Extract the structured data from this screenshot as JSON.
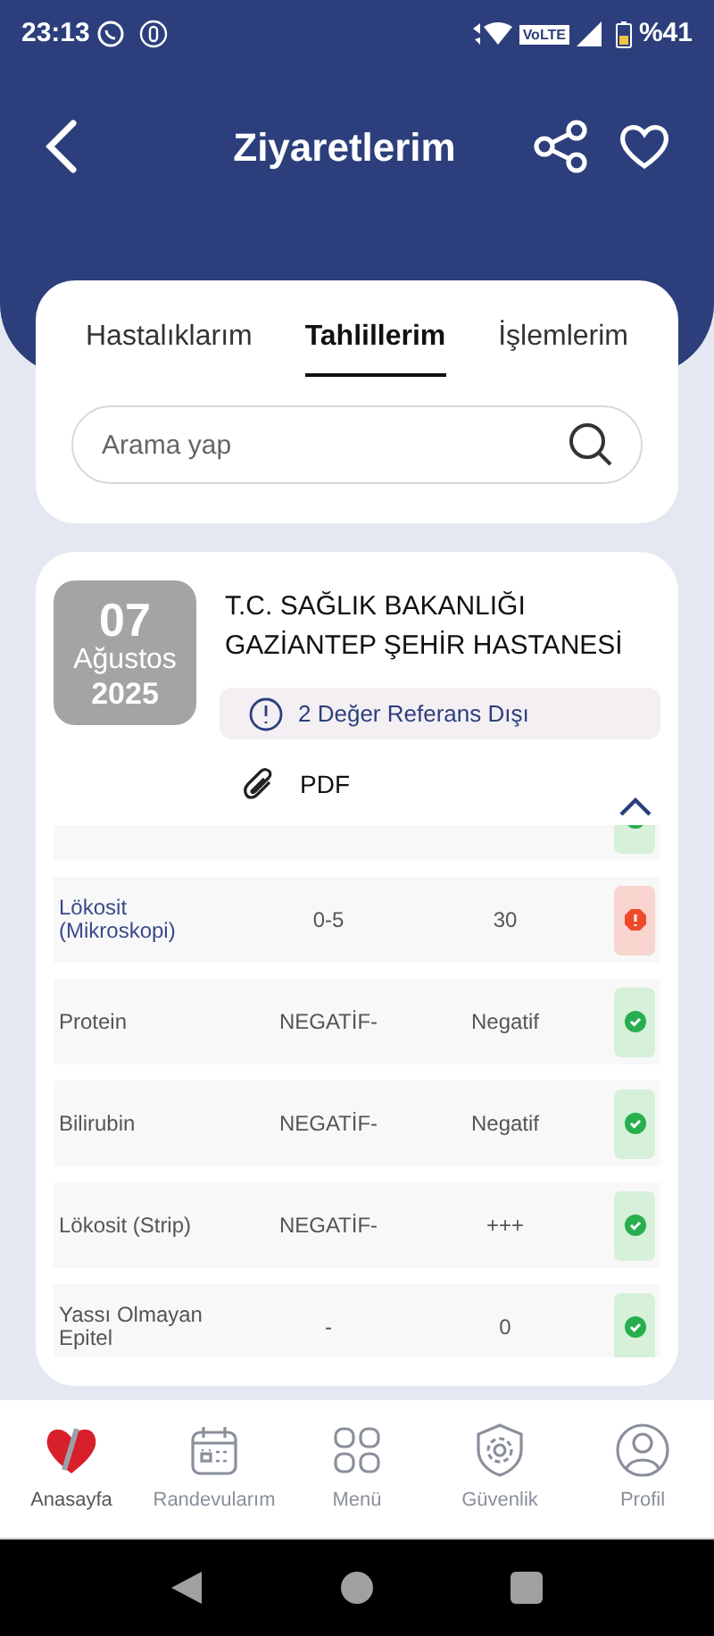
{
  "status_bar": {
    "time": "23:13",
    "battery": "%41",
    "volte": "VoLTE"
  },
  "header": {
    "title": "Ziyaretlerim"
  },
  "tabs": [
    {
      "label": "Hastalıklarım",
      "selected": false
    },
    {
      "label": "Tahlillerim",
      "selected": true
    },
    {
      "label": "İşlemlerim",
      "selected": false
    }
  ],
  "search": {
    "placeholder": "Arama yap"
  },
  "visit": {
    "day": "07",
    "month": "Ağustos",
    "year": "2025",
    "hospital": "T.C. SAĞLIK BAKANLIĞI GAZİANTEP ŞEHİR HASTANESİ",
    "alert": "2 Değer Referans Dışı",
    "attachment": "PDF",
    "expanded": true
  },
  "results": [
    {
      "out_of_range": false
    },
    {
      "name": "Lökosit (Mikroskopi)",
      "reference": "0-5",
      "value": "30",
      "out_of_range": true
    },
    {
      "name": "Protein",
      "reference": "NEGATİF-",
      "value": "Negatif",
      "out_of_range": false
    },
    {
      "name": "Bilirubin",
      "reference": "NEGATİF-",
      "value": "Negatif",
      "out_of_range": false
    },
    {
      "name": "Lökosit (Strip)",
      "reference": "NEGATİF-",
      "value": "+++",
      "out_of_range": false
    },
    {
      "name": "Yassı Olmayan Epitel",
      "reference": "-",
      "value": "0",
      "out_of_range": false
    }
  ],
  "bottom_nav": [
    {
      "label": "Anasayfa",
      "kind": "home",
      "selected": true
    },
    {
      "label": "Randevularım",
      "kind": "calendar",
      "selected": false
    },
    {
      "label": "Menü",
      "kind": "grid",
      "selected": false
    },
    {
      "label": "Güvenlik",
      "kind": "shield",
      "selected": false
    },
    {
      "label": "Profil",
      "kind": "profile",
      "selected": false
    }
  ]
}
